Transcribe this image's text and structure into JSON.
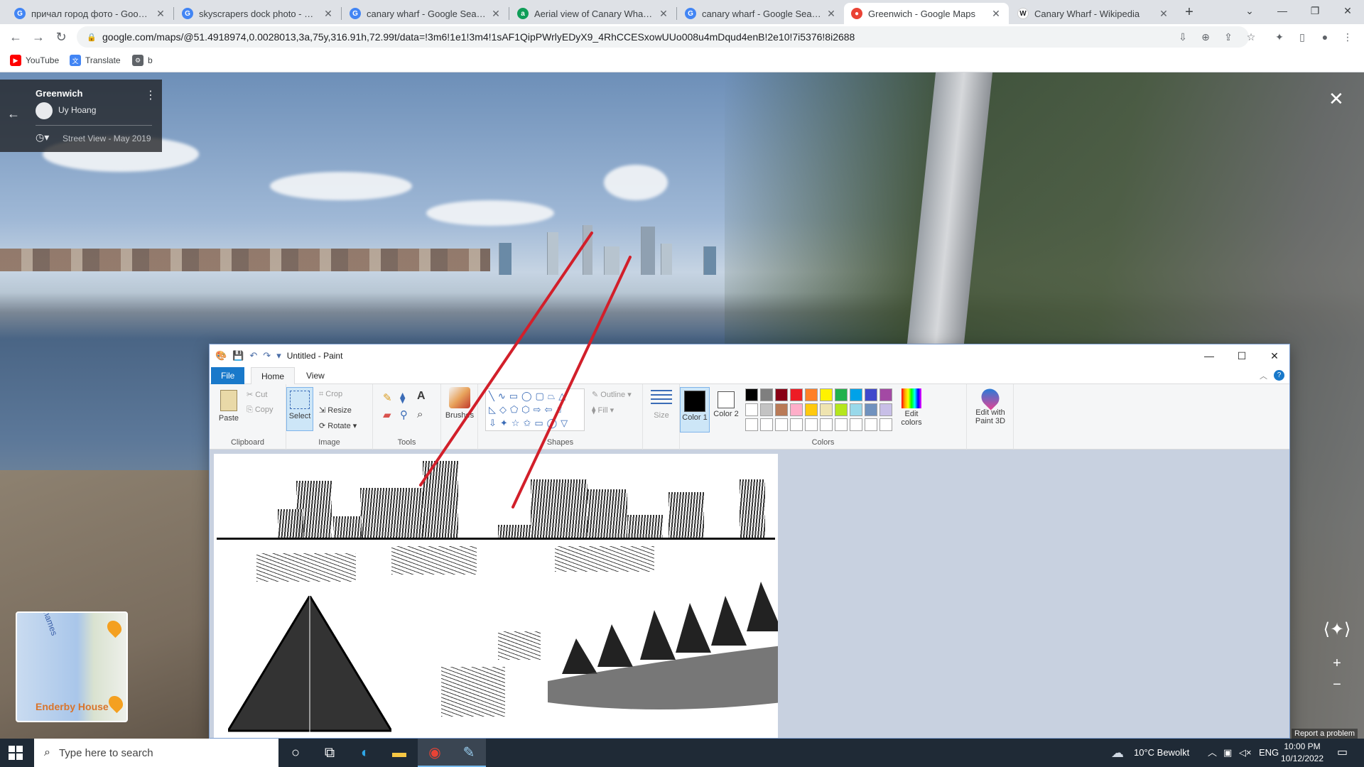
{
  "browser": {
    "tabs": [
      {
        "title": "причал город фото - Google Se",
        "icon": "google-g-icon",
        "color": "#4285f4",
        "active": false
      },
      {
        "title": "skyscrapers dock photo - Goog",
        "icon": "google-g-icon",
        "color": "#4285f4",
        "active": false
      },
      {
        "title": "canary wharf - Google Search",
        "icon": "google-g-icon",
        "color": "#4285f4",
        "active": false
      },
      {
        "title": "Aerial view of Canary Wharf, Lo",
        "icon": "a-icon",
        "color": "#0f9d58",
        "active": false
      },
      {
        "title": "canary wharf - Google Search",
        "icon": "google-g-icon",
        "color": "#4285f4",
        "active": false
      },
      {
        "title": "Greenwich - Google Maps",
        "icon": "maps-pin-icon",
        "color": "#ea4335",
        "active": true
      },
      {
        "title": "Canary Wharf - Wikipedia",
        "icon": "wikipedia-w-icon",
        "color": "#202124",
        "active": false
      }
    ],
    "url": "google.com/maps/@51.4918974,0.0028013,3a,75y,316.91h,72.99t/data=!3m6!1e1!3m4!1sAF1QipPWrlyEDyX9_4RhCCESxowUUo008u4mDqud4enB!2e10!7i5376!8i2688",
    "bookmarks": [
      {
        "label": "YouTube",
        "icon": "youtube-icon",
        "color": "#ff0000"
      },
      {
        "label": "Translate",
        "icon": "translate-icon",
        "color": "#4285f4"
      },
      {
        "label": "b",
        "icon": "b-icon",
        "color": "#5f6368"
      }
    ]
  },
  "streetview": {
    "place": "Greenwich",
    "author": "Uy Hoang",
    "date": "Street View - May 2019",
    "minimap_label": "Enderby House",
    "minimap_water": "Thames",
    "report": "Report a problem"
  },
  "paint": {
    "title": "Untitled - Paint",
    "tabs": {
      "file": "File",
      "home": "Home",
      "view": "View"
    },
    "clipboard": {
      "paste": "Paste",
      "cut": "Cut",
      "copy": "Copy",
      "group": "Clipboard"
    },
    "image": {
      "select": "Select",
      "crop": "Crop",
      "resize": "Resize",
      "rotate": "Rotate",
      "group": "Image"
    },
    "tools": {
      "group": "Tools"
    },
    "brushes": "Brushes",
    "shapes": {
      "outline": "Outline",
      "fill": "Fill",
      "group": "Shapes"
    },
    "size": "Size",
    "color1": "Color 1",
    "color2": "Color 2",
    "colors_group": "Colors",
    "edit_colors": "Edit colors",
    "edit_paint3d": "Edit with Paint 3D",
    "palette_row1": [
      "#000000",
      "#7f7f7f",
      "#880015",
      "#ed1c24",
      "#ff7f27",
      "#fff200",
      "#22b14c",
      "#00a2e8",
      "#3f48cc",
      "#a349a4"
    ],
    "palette_row2": [
      "#ffffff",
      "#c3c3c3",
      "#b97a57",
      "#ffaec9",
      "#ffc90e",
      "#efe4b0",
      "#b5e61d",
      "#99d9ea",
      "#7092be",
      "#c8bfe7"
    ]
  },
  "taskbar": {
    "search_placeholder": "Type here to search",
    "weather": "10°C  Bewolkt",
    "lang": "ENG",
    "time": "10:00 PM",
    "date": "10/12/2022"
  }
}
